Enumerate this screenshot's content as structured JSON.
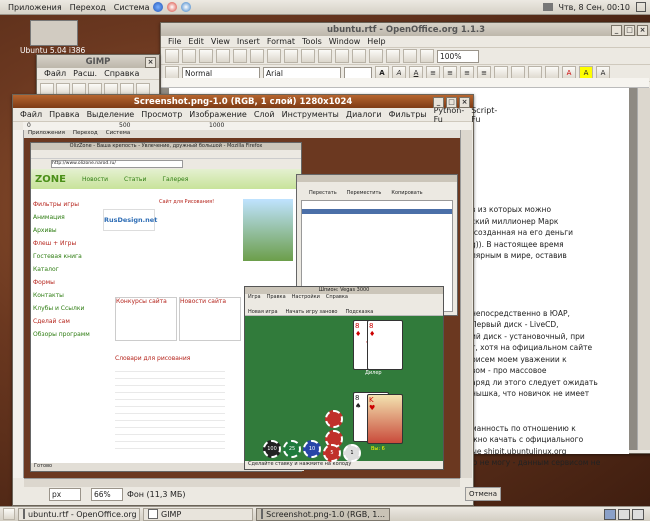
{
  "top_panel": {
    "menus": [
      "Приложения",
      "Переход",
      "Система"
    ],
    "clock": "Чтв,  8 Сен, 00:10"
  },
  "desktop": {
    "icon_label": "Ubuntu 5.04 i386"
  },
  "gimp_toolbox": {
    "title": "GIMP",
    "menus": [
      "Файл",
      "Расш.",
      "Справка"
    ]
  },
  "openoffice": {
    "title": "ubuntu.rtf - OpenOffice.org 1.1.3",
    "menus": [
      "File",
      "Edit",
      "View",
      "Insert",
      "Format",
      "Tools",
      "Window",
      "Help"
    ],
    "style_value": "Normal",
    "font_value": "Arial",
    "zoom_value": "100%",
    "doc_lines": [
      "в из которых можно",
      "ский миллионер Марк",
      "(созданная на его деньги",
      "g)). В настоящее время",
      "лярным в мире, оставив",
      "",
      "",
      "",
      "",
      "непосредственно в ЮАР,",
      "Первый диск - LiveCD,",
      "ий диск - установочный, при",
      "т, хотя на официальном сайте",
      "рисем моем уважении к",
      "вом - про массовое",
      "аряд ли этого следует ожидать",
      "нышка, что новичок не имеет",
      "",
      "",
      "манность по отношению к",
      "жно качать с официального",
      "ые shipit.ubuntulinux.org",
      "ю не могу - данным сервисом не"
    ],
    "doc_link_text": "LiveCD"
  },
  "gimp_image": {
    "title": "Screenshot.png-1.0 (RGB, 1 слой) 1280x1024",
    "menus": [
      "Файл",
      "Правка",
      "Выделение",
      "Просмотр",
      "Изображение",
      "Слой",
      "Инструменты",
      "Диалоги",
      "Фильтры",
      "Python-Fu",
      "Script-Fu"
    ],
    "ruler_marks": [
      "0",
      "500",
      "1000"
    ],
    "status_unit": "px",
    "status_zoom": "66%",
    "status_text": "Фон (11,3 МБ)",
    "cancel_label": "Отмена"
  },
  "inner_panel": {
    "menus": [
      "Приложения",
      "Переход",
      "Система"
    ]
  },
  "inner_firefox": {
    "title": "OlizZone - Ваша крепость - Увлечение, дружный большой - Mozilla Firefox",
    "url": "http://www.olizone.narod.ru/",
    "site_name": "ZONE",
    "nav_items": [
      "Новости",
      "Статьи",
      "Галерея"
    ],
    "left_links": [
      "Фильтры игры",
      "Анимация",
      "Архивы",
      "Флеш + Игры",
      "Гостевая книга",
      "Каталог",
      "Формы",
      "Контакты",
      "Клубы и Ссылки",
      "Сделай сам",
      "Обзоры программ"
    ],
    "center_logo": "RusDesign.net",
    "banner_text": "Сайт для Рисования!",
    "center_headings": [
      "Конкурсы сайта",
      "Новости сайта",
      "Словари для рисования"
    ],
    "status_text": "Готово"
  },
  "inner_filemanager": {
    "toolbar_labels": [
      "Перестать",
      "Переместить",
      "Копировать"
    ]
  },
  "solitaire": {
    "title": "Шпион: Vegas 3000",
    "menus": [
      "Игра",
      "Правка",
      "Настройки",
      "Справка"
    ],
    "toolbar_labels": [
      "Новая игра",
      "Начать игру заново",
      "Подсказка"
    ],
    "dealer_label": "Дилер",
    "player_label": "Вы: 6",
    "chips": [
      "100",
      "25",
      "10",
      "5",
      "1"
    ],
    "status_text": "Сделайте ставку и нажмите на колоду"
  },
  "bottom_panel": {
    "tasks": [
      "ubuntu.rtf - OpenOffice.org 1.1.3",
      "GIMP",
      "Screenshot.png-1.0 (RGB, 1..."
    ]
  },
  "colors": {
    "accent_orange": "#b6652f",
    "felt_green": "#317b3b",
    "chip_red": "#c0302a"
  }
}
